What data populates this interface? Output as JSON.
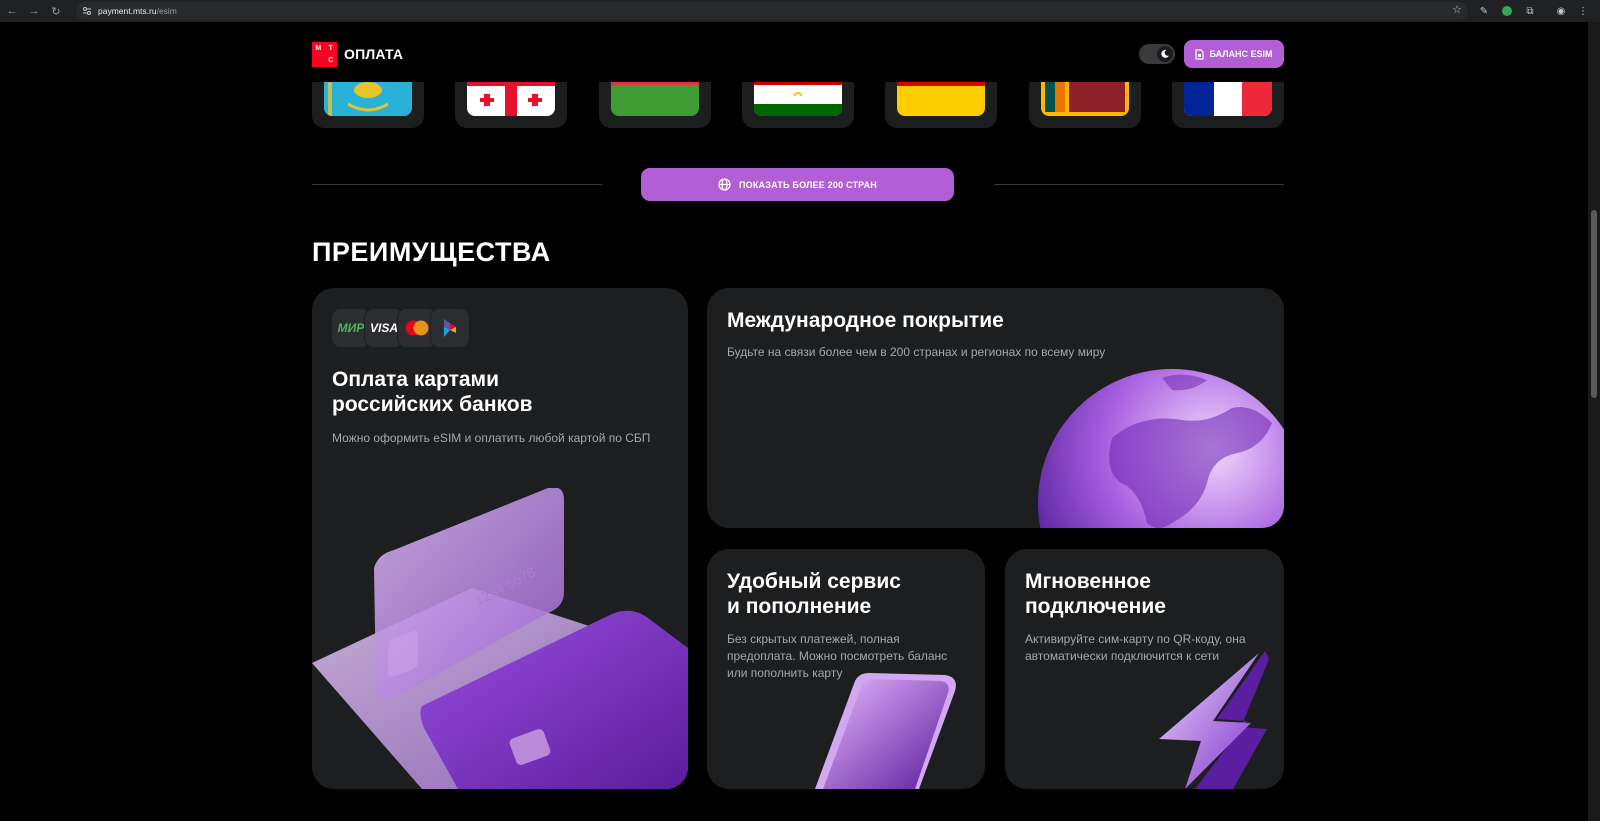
{
  "browser": {
    "url_host": "payment.mts.ru",
    "url_path": "/esim"
  },
  "header": {
    "logo_letters": [
      "М",
      "Т",
      "С"
    ],
    "brand": "ОПЛАТА",
    "balance_button": "БАЛАНС ESIM"
  },
  "flags": [
    {
      "country": "kazakhstan"
    },
    {
      "country": "georgia"
    },
    {
      "country": "azerbaijan"
    },
    {
      "country": "tajikistan"
    },
    {
      "country": "germany"
    },
    {
      "country": "sri-lanka"
    },
    {
      "country": "france"
    }
  ],
  "show_more": {
    "label": "ПОКАЗАТЬ БОЛЕЕ 200 СТРАН"
  },
  "advantages": {
    "title": "ПРЕИМУЩЕСТВА",
    "payment": {
      "logos": [
        "МИР",
        "VISA",
        "mastercard",
        "sbp"
      ],
      "mir_label": "МИР",
      "visa_label": "VISA",
      "title_line1": "Оплата картами",
      "title_line2": "российских банков",
      "text": "Можно оформить eSIM и оплатить любой картой по СБП",
      "card_number": "1234 5678"
    },
    "coverage": {
      "title": "Международное покрытие",
      "text": "Будьте на связи более чем в 200 странах и регионах по всему миру"
    },
    "service": {
      "title_line1": "Удобный сервис",
      "title_line2": "и пополнение",
      "text": "Без скрытых платежей, полная предоплата. Можно посмотреть баланс или пополнить карту"
    },
    "instant": {
      "title_line1": "Мгновенное",
      "title_line2": "подключение",
      "text": "Активируйте сим-карту по QR-коду, она автоматически подключится к сети"
    }
  },
  "colors": {
    "accent": "#b25ed4",
    "card_bg": "#1d1e20",
    "mts_red": "#ff0023"
  }
}
